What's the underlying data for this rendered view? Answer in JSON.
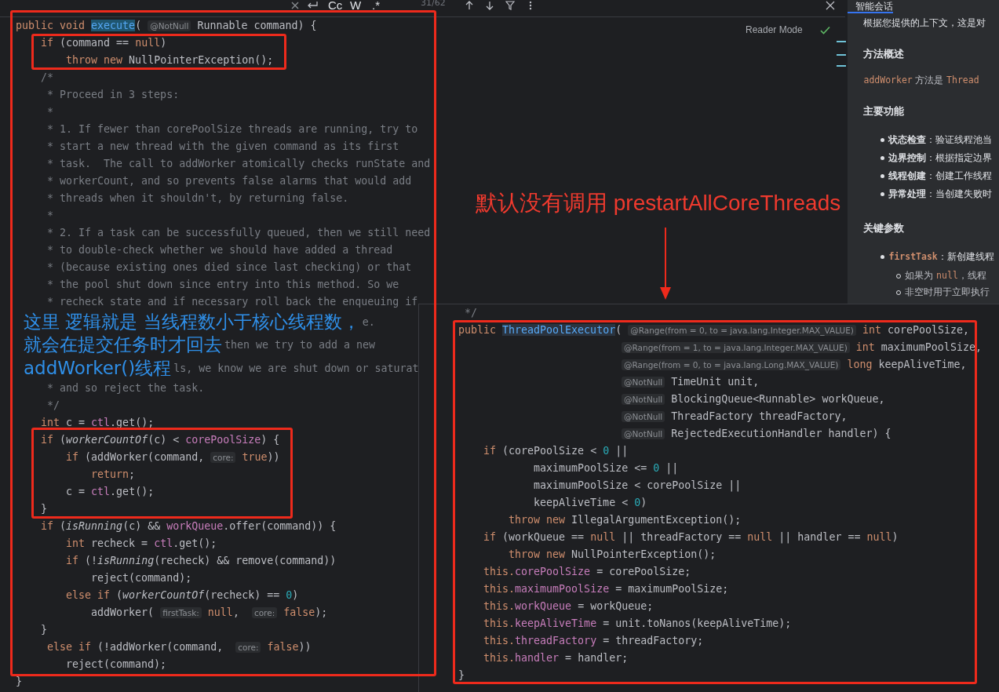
{
  "find_bar": {
    "case_toggle": "Cc",
    "word_toggle": "W",
    "regex_toggle": ".*",
    "match_count": "31/62"
  },
  "reader_mode": "Reader Mode",
  "editor": {
    "lines_before": [
      [
        {
          "text": "public void ",
          "kind": "kw"
        },
        {
          "text": "execute",
          "kind": "sel"
        },
        {
          "text": "( ",
          "kind": "plain"
        },
        {
          "text": "@NotNull",
          "kind": "hint"
        },
        {
          "text": " Runnable command) {",
          "kind": "plain"
        }
      ],
      [
        {
          "text": "    if",
          "kind": "kw"
        },
        {
          "text": " (command == ",
          "kind": "plain"
        },
        {
          "text": "null",
          "kind": "kw"
        },
        {
          "text": ")",
          "kind": "plain"
        }
      ],
      [
        {
          "text": "        throw new ",
          "kind": "kw"
        },
        {
          "text": "NullPointerException();",
          "kind": "plain"
        }
      ],
      [
        {
          "text": "    /*",
          "kind": "comment"
        }
      ],
      [
        {
          "text": "     * Proceed in 3 steps:",
          "kind": "comment"
        }
      ],
      [
        {
          "text": "     *",
          "kind": "comment"
        }
      ],
      [
        {
          "text": "     * 1. If fewer than corePoolSize threads are running, try to",
          "kind": "comment"
        }
      ],
      [
        {
          "text": "     * start a new thread with the given command as its first",
          "kind": "comment"
        }
      ],
      [
        {
          "text": "     * task.  The call to addWorker atomically checks runState and",
          "kind": "comment"
        }
      ],
      [
        {
          "text": "     * workerCount, and so prevents false alarms that would add",
          "kind": "comment"
        }
      ],
      [
        {
          "text": "     * threads when it shouldn't, by returning false.",
          "kind": "comment"
        }
      ],
      [
        {
          "text": "     *",
          "kind": "comment"
        }
      ],
      [
        {
          "text": "     * 2. If a task can be successfully queued, then we still need",
          "kind": "comment"
        }
      ],
      [
        {
          "text": "     * to double-check whether we should have added a thread",
          "kind": "comment"
        }
      ],
      [
        {
          "text": "     * (because existing ones died since last checking) or that",
          "kind": "comment"
        }
      ],
      [
        {
          "text": "     * the pool shut down since entry into this method. So we",
          "kind": "comment"
        }
      ],
      [
        {
          "text": "     * recheck state and if necessary roll back the enqueuing if",
          "kind": "comment"
        }
      ]
    ],
    "note_rows": [
      {
        "note": "这里 逻辑就是 当线程数小于核心线程数，",
        "code": "e."
      },
      {
        "note": "就会在提交任务时才回去",
        "code": "then we try to add a new"
      },
      {
        "note": "addWorker()线程",
        "code": "ls, we know we are shut down or saturat"
      }
    ],
    "lines_after": [
      [
        {
          "text": "     * and so reject the task.",
          "kind": "comment"
        }
      ],
      [
        {
          "text": "     */",
          "kind": "comment"
        }
      ],
      [
        {
          "text": "    int",
          "kind": "kw"
        },
        {
          "text": " c = ",
          "kind": "plain"
        },
        {
          "text": "ctl",
          "kind": "field"
        },
        {
          "text": ".get();",
          "kind": "plain"
        }
      ],
      [
        {
          "text": "    if",
          "kind": "kw"
        },
        {
          "text": " (",
          "kind": "plain"
        },
        {
          "text": "workerCountOf",
          "kind": "italic"
        },
        {
          "text": "(c) < ",
          "kind": "plain"
        },
        {
          "text": "corePoolSize",
          "kind": "field"
        },
        {
          "text": ") {",
          "kind": "plain"
        }
      ],
      [
        {
          "text": "        if",
          "kind": "kw"
        },
        {
          "text": " (addWorker(command, ",
          "kind": "plain"
        },
        {
          "text": "core:",
          "kind": "hint"
        },
        {
          "text": " true",
          "kind": "kw"
        },
        {
          "text": "))",
          "kind": "plain"
        }
      ],
      [
        {
          "text": "            return",
          "kind": "kw"
        },
        {
          "text": ";",
          "kind": "plain"
        }
      ],
      [
        {
          "text": "        c = ",
          "kind": "plain"
        },
        {
          "text": "ctl",
          "kind": "field"
        },
        {
          "text": ".get();",
          "kind": "plain"
        }
      ],
      [
        {
          "text": "    }",
          "kind": "plain"
        }
      ],
      [
        {
          "text": "    if",
          "kind": "kw"
        },
        {
          "text": " (",
          "kind": "plain"
        },
        {
          "text": "isRunning",
          "kind": "italic"
        },
        {
          "text": "(c) && ",
          "kind": "plain"
        },
        {
          "text": "workQueue",
          "kind": "field"
        },
        {
          "text": ".offer(command)) {",
          "kind": "plain"
        }
      ],
      [
        {
          "text": "        int",
          "kind": "kw"
        },
        {
          "text": " recheck = ",
          "kind": "plain"
        },
        {
          "text": "ctl",
          "kind": "field"
        },
        {
          "text": ".get();",
          "kind": "plain"
        }
      ],
      [
        {
          "text": "        if",
          "kind": "kw"
        },
        {
          "text": " (!",
          "kind": "plain"
        },
        {
          "text": "isRunning",
          "kind": "italic"
        },
        {
          "text": "(recheck) && remove(command))",
          "kind": "plain"
        }
      ],
      [
        {
          "text": "            reject(command);",
          "kind": "plain"
        }
      ],
      [
        {
          "text": "        else if",
          "kind": "kw"
        },
        {
          "text": " (",
          "kind": "plain"
        },
        {
          "text": "workerCountOf",
          "kind": "italic"
        },
        {
          "text": "(recheck) == ",
          "kind": "plain"
        },
        {
          "text": "0",
          "kind": "num"
        },
        {
          "text": ")",
          "kind": "plain"
        }
      ],
      [
        {
          "text": "            addWorker( ",
          "kind": "plain"
        },
        {
          "text": "firstTask:",
          "kind": "hint"
        },
        {
          "text": " null",
          "kind": "kw"
        },
        {
          "text": ",  ",
          "kind": "plain"
        },
        {
          "text": "core:",
          "kind": "hint"
        },
        {
          "text": " false",
          "kind": "kw"
        },
        {
          "text": ");",
          "kind": "plain"
        }
      ],
      [
        {
          "text": "    }",
          "kind": "plain"
        }
      ],
      [
        {
          "text": "     else if",
          "kind": "kw"
        },
        {
          "text": " (!addWorker(command,  ",
          "kind": "plain"
        },
        {
          "text": "core:",
          "kind": "hint"
        },
        {
          "text": " false",
          "kind": "kw"
        },
        {
          "text": "))",
          "kind": "plain"
        }
      ],
      [
        {
          "text": "        reject(command);",
          "kind": "plain"
        }
      ],
      [
        {
          "text": "}",
          "kind": "plain"
        }
      ]
    ]
  },
  "red_note": "默认没有调用 prestartAllCoreThreads",
  "popup": {
    "lines": [
      [
        {
          "text": " */",
          "kind": "comment"
        }
      ],
      [
        {
          "text": "public ",
          "kind": "kw"
        },
        {
          "text": "ThreadPoolExecutor",
          "kind": "sel2"
        },
        {
          "text": "( ",
          "kind": "plain"
        },
        {
          "text": "@Range(from = 0, to = java.lang.Integer.MAX_VALUE)",
          "kind": "hint"
        },
        {
          "text": " int",
          "kind": "kw"
        },
        {
          "text": " corePoolSize,",
          "kind": "plain"
        }
      ],
      [
        {
          "text": "@Range(from = 1, to = java.lang.Integer.MAX_VALUE)",
          "kind": "param_hint"
        },
        {
          "text": " int",
          "kind": "kw"
        },
        {
          "text": " maximumPoolSize,",
          "kind": "plain"
        }
      ],
      [
        {
          "text": "@Range(from = 0, to = java.lang.Long.MAX_VALUE)",
          "kind": "param_hint"
        },
        {
          "text": " long",
          "kind": "kw"
        },
        {
          "text": " keepAliveTime,",
          "kind": "plain"
        }
      ],
      [
        {
          "text": "@NotNull",
          "kind": "param_hint"
        },
        {
          "text": " TimeUnit unit,",
          "kind": "plain"
        }
      ],
      [
        {
          "text": "@NotNull",
          "kind": "param_hint"
        },
        {
          "text": " BlockingQueue<Runnable> workQueue,",
          "kind": "plain"
        }
      ],
      [
        {
          "text": "@NotNull",
          "kind": "param_hint"
        },
        {
          "text": " ThreadFactory threadFactory,",
          "kind": "plain"
        }
      ],
      [
        {
          "text": "@NotNull",
          "kind": "param_hint"
        },
        {
          "text": " RejectedExecutionHandler handler) {",
          "kind": "plain"
        }
      ],
      [
        {
          "text": "    if",
          "kind": "kw"
        },
        {
          "text": " (corePoolSize < ",
          "kind": "plain"
        },
        {
          "text": "0",
          "kind": "num"
        },
        {
          "text": " ||",
          "kind": "plain"
        }
      ],
      [
        {
          "text": "            maximumPoolSize <= ",
          "kind": "plain"
        },
        {
          "text": "0",
          "kind": "num"
        },
        {
          "text": " ||",
          "kind": "plain"
        }
      ],
      [
        {
          "text": "            maximumPoolSize < corePoolSize ||",
          "kind": "plain"
        }
      ],
      [
        {
          "text": "            keepAliveTime < ",
          "kind": "plain"
        },
        {
          "text": "0",
          "kind": "num"
        },
        {
          "text": ")",
          "kind": "plain"
        }
      ],
      [
        {
          "text": "        throw new ",
          "kind": "kw"
        },
        {
          "text": "IllegalArgumentException();",
          "kind": "plain"
        }
      ],
      [
        {
          "text": "    if",
          "kind": "kw"
        },
        {
          "text": " (workQueue == ",
          "kind": "plain"
        },
        {
          "text": "null",
          "kind": "kw"
        },
        {
          "text": " || threadFactory == ",
          "kind": "plain"
        },
        {
          "text": "null",
          "kind": "kw"
        },
        {
          "text": " || handler == ",
          "kind": "plain"
        },
        {
          "text": "null",
          "kind": "kw"
        },
        {
          "text": ")",
          "kind": "plain"
        }
      ],
      [
        {
          "text": "        throw new ",
          "kind": "kw"
        },
        {
          "text": "NullPointerException();",
          "kind": "plain"
        }
      ],
      [
        {
          "text": "    this.",
          "kind": "kw"
        },
        {
          "text": "corePoolSize",
          "kind": "field"
        },
        {
          "text": " = corePoolSize;",
          "kind": "plain"
        }
      ],
      [
        {
          "text": "    this.",
          "kind": "kw"
        },
        {
          "text": "maximumPoolSize",
          "kind": "field"
        },
        {
          "text": " = maximumPoolSize;",
          "kind": "plain"
        }
      ],
      [
        {
          "text": "    this.",
          "kind": "kw"
        },
        {
          "text": "workQueue",
          "kind": "field"
        },
        {
          "text": " = workQueue;",
          "kind": "plain"
        }
      ],
      [
        {
          "text": "    this.",
          "kind": "kw"
        },
        {
          "text": "keepAliveTime",
          "kind": "field"
        },
        {
          "text": " = unit.toNanos(keepAliveTime);",
          "kind": "plain"
        }
      ],
      [
        {
          "text": "    this.",
          "kind": "kw"
        },
        {
          "text": "threadFactory",
          "kind": "field"
        },
        {
          "text": " = threadFactory;",
          "kind": "plain"
        }
      ],
      [
        {
          "text": "    this.",
          "kind": "kw"
        },
        {
          "text": "handler",
          "kind": "field"
        },
        {
          "text": " = handler;",
          "kind": "plain"
        }
      ],
      [
        {
          "text": "}",
          "kind": "plain"
        }
      ]
    ]
  },
  "chat": {
    "tab": "智能会话",
    "intro": "根据您提供的上下文，这是对",
    "sections": [
      {
        "heading": "方法概述",
        "paragraph": [
          {
            "text": "addWorker",
            "kind": "code"
          },
          {
            "text": " 方法是 ",
            "kind": "plain"
          },
          {
            "text": "Thread",
            "kind": "code"
          }
        ]
      },
      {
        "heading": "主要功能",
        "bullets": [
          {
            "term": "状态检查",
            "text": "：验证线程池当"
          },
          {
            "term": "边界控制",
            "text": "：根据指定边界"
          },
          {
            "term": "线程创建",
            "text": "：创建工作线程"
          },
          {
            "term": "异常处理",
            "text": "：当创建失败时"
          }
        ]
      },
      {
        "heading": "关键参数",
        "params": [
          {
            "term": "firstTask",
            "text": "：新创建线程",
            "sub": [
              [
                {
                  "text": "如果为 ",
                  "kind": "plain"
                },
                {
                  "text": "null",
                  "kind": "code"
                },
                {
                  "text": "，线程",
                  "kind": "plain"
                }
              ],
              [
                {
                  "text": "非空时用于立即执行",
                  "kind": "plain"
                }
              ]
            ]
          }
        ]
      }
    ]
  }
}
